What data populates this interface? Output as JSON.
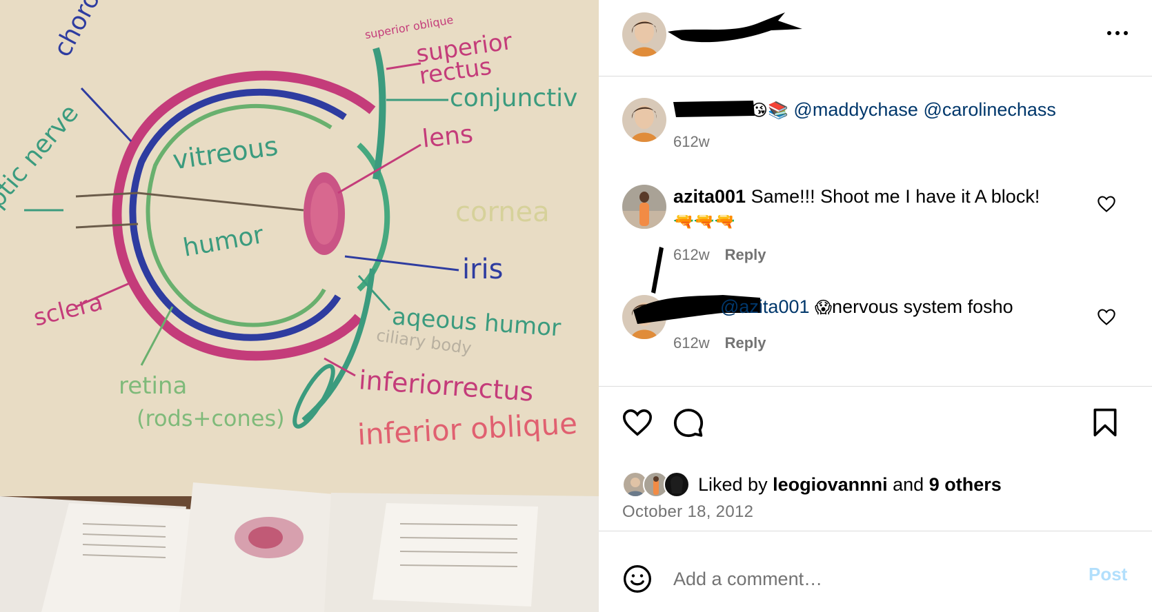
{
  "photo": {
    "board_labels": {
      "choroid": "choroid",
      "optic_nerve": "optic nerve",
      "superior_oblique": "superior oblique",
      "superior_rectus": "superior rectus",
      "conjunctiva": "conjunctiv",
      "lens": "lens",
      "vitreous": "vitreous",
      "humor": "humor",
      "cornea": "cornea",
      "iris": "iris",
      "sclera": "sclera",
      "aqueous_humor": "aqeous humor",
      "ciliary_body": "ciliary body",
      "retina": "retina",
      "rods_cones": "(rods+cones)",
      "inferior_rectus": "inferiorrectus",
      "inferior_oblique": "inferior oblique"
    }
  },
  "header": {
    "more_label": "•••"
  },
  "caption": {
    "emoji": "😘📚",
    "mention_1": "@maddychase",
    "mention_2": "@carolinechass",
    "time": "612w"
  },
  "comments": [
    {
      "username": "azita001",
      "text": "Same!!! Shoot me I have it A block!",
      "emoji": "🔫🔫🔫",
      "time": "612w",
      "reply": "Reply"
    },
    {
      "mention": "@azita001",
      "emoji": "😱",
      "text": "nervous system fosho",
      "time": "612w",
      "reply": "Reply"
    }
  ],
  "likes": {
    "prefix": "Liked by",
    "user": "leogiovannni",
    "conj": "and",
    "others": "9 others"
  },
  "date": "October 18, 2012",
  "add_comment": {
    "placeholder": "Add a comment…",
    "post_label": "Post"
  },
  "colors": {
    "mention": "#00376b",
    "muted": "#737373",
    "divider": "#dbdbdb",
    "post_disabled": "#b2dffc"
  },
  "icons": {
    "more": "more-dots-icon",
    "heart": "heart-icon",
    "comment": "comment-icon",
    "bookmark": "bookmark-icon",
    "emoji": "emoji-smile-icon"
  }
}
